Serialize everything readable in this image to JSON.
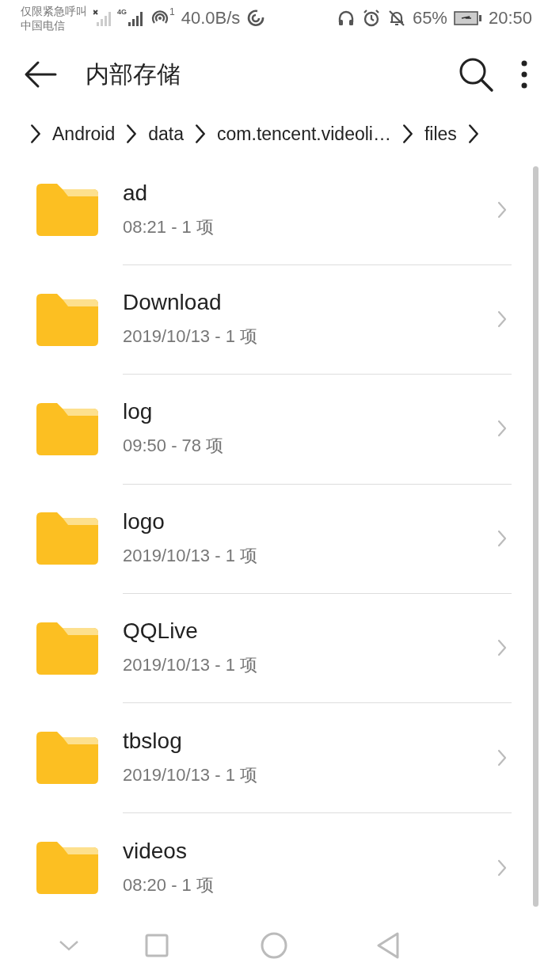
{
  "status_bar": {
    "emergency": "仅限紧急呼叫",
    "carrier": "中国电信",
    "network_type": "4G",
    "hotspot_count": "1",
    "speed": "40.0B/s",
    "battery": "65%",
    "time": "20:50"
  },
  "app_bar": {
    "title": "内部存储"
  },
  "breadcrumb": [
    "Android",
    "data",
    "com.tencent.videoli…",
    "files"
  ],
  "folders": [
    {
      "name": "ad",
      "meta": "08:21 - 1 项"
    },
    {
      "name": "Download",
      "meta": "2019/10/13 - 1 项"
    },
    {
      "name": "log",
      "meta": "09:50 - 78 项"
    },
    {
      "name": "logo",
      "meta": "2019/10/13 - 1 项"
    },
    {
      "name": "QQLive",
      "meta": "2019/10/13 - 1 项"
    },
    {
      "name": "tbslog",
      "meta": "2019/10/13 - 1 项"
    },
    {
      "name": "videos",
      "meta": "08:20 - 1 项"
    }
  ]
}
